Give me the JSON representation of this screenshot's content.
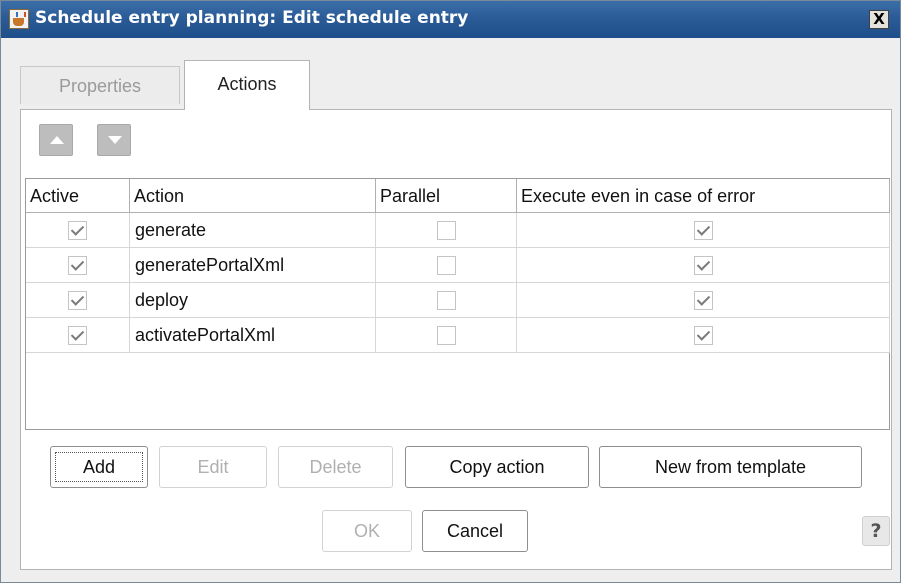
{
  "window": {
    "title": "Schedule entry planning: Edit schedule entry",
    "close_label": "X"
  },
  "tabs": [
    {
      "label": "Properties",
      "selected": false
    },
    {
      "label": "Actions",
      "selected": true
    }
  ],
  "table": {
    "columns": [
      "Active",
      "Action",
      "Parallel",
      "Execute even in case of error"
    ],
    "rows": [
      {
        "active": true,
        "action": "generate",
        "parallel": false,
        "execute_on_error": true
      },
      {
        "active": true,
        "action": "generatePortalXml",
        "parallel": false,
        "execute_on_error": true
      },
      {
        "active": true,
        "action": "deploy",
        "parallel": false,
        "execute_on_error": true
      },
      {
        "active": true,
        "action": "activatePortalXml",
        "parallel": false,
        "execute_on_error": true
      }
    ]
  },
  "buttons": {
    "add": "Add",
    "edit": "Edit",
    "delete": "Delete",
    "copy_action": "Copy action",
    "new_from_template": "New from template"
  },
  "footer": {
    "ok": "OK",
    "cancel": "Cancel",
    "help": "?"
  },
  "icons": {
    "app": "java-icon",
    "move_up": "arrow-up-icon",
    "move_down": "arrow-down-icon"
  }
}
